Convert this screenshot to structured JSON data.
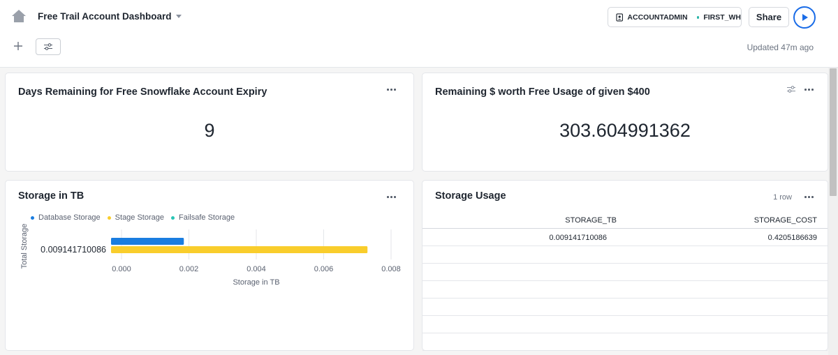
{
  "header": {
    "title": "Free Trail Account Dashboard",
    "role": "ACCOUNTADMIN",
    "warehouse": "FIRST_WH",
    "share_label": "Share",
    "updated": "Updated 47m ago"
  },
  "tiles": {
    "days_remaining": {
      "title": "Days Remaining for Free Snowflake Account Expiry",
      "value": "9"
    },
    "remaining_usage": {
      "title": "Remaining $ worth Free Usage of given $400",
      "value": "303.604991362"
    },
    "storage_chart": {
      "title": "Storage in TB"
    },
    "storage_usage": {
      "title": "Storage Usage",
      "row_count": "1 row",
      "columns": [
        "STORAGE_TB",
        "STORAGE_COST"
      ],
      "rows": [
        [
          "0.009141710086",
          "0.4205186639"
        ]
      ]
    }
  },
  "chart_data": {
    "type": "bar",
    "orientation": "horizontal",
    "categories": [
      "0.009141710086"
    ],
    "series": [
      {
        "name": "Database Storage",
        "values": [
          0.00185
        ],
        "color": "#1a7de0"
      },
      {
        "name": "Stage Storage",
        "values": [
          0.0073
        ],
        "color": "#f9cd2c"
      },
      {
        "name": "Failsafe Storage",
        "values": [
          0
        ],
        "color": "#29c5b5"
      }
    ],
    "xlabel": "Storage in TB",
    "ylabel": "Total Storage",
    "xlim": [
      0,
      0.008
    ],
    "xticks": [
      "0.000",
      "0.002",
      "0.004",
      "0.006",
      "0.008"
    ],
    "legend": "top-left",
    "grid": true
  },
  "icons": {
    "home": "home-icon",
    "add": "plus-icon",
    "filter": "sliders-icon",
    "more": "ellipsis-icon",
    "role": "user-badge-icon",
    "run": "play-icon"
  }
}
